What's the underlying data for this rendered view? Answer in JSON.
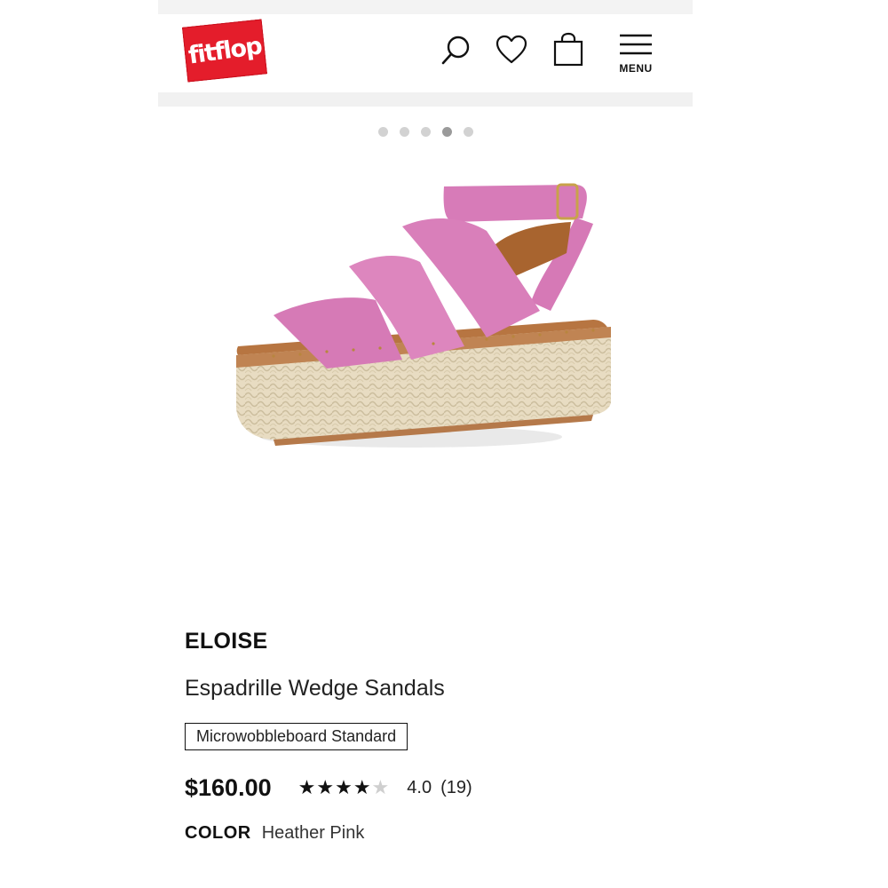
{
  "header": {
    "logo_text": "fitflop",
    "menu_label": "MENU",
    "icons": [
      "search-icon",
      "heart-icon",
      "bag-icon",
      "menu-icon"
    ],
    "brand_color": "#e41d2b"
  },
  "carousel": {
    "dot_count": 5,
    "active_index": 3
  },
  "product": {
    "name": "ELOISE",
    "subtitle": "Espadrille Wedge Sandals",
    "tag": "Microwobbleboard Standard",
    "price": "$160.00",
    "rating_stars": 4,
    "rating_max": 5,
    "rating_value": "4.0",
    "review_count": "(19)",
    "color_label": "COLOR",
    "color_value": "Heather Pink"
  }
}
